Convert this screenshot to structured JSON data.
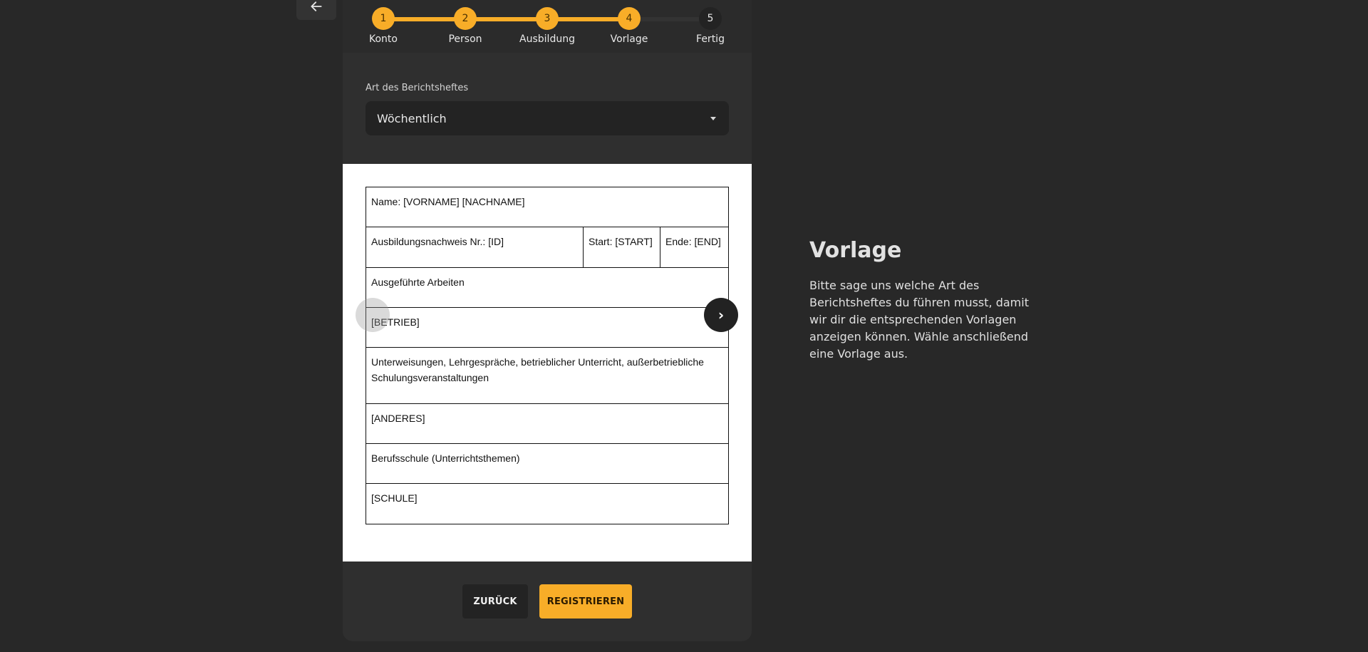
{
  "stepper": {
    "steps": [
      {
        "number": "1",
        "label": "Konto",
        "state": "done"
      },
      {
        "number": "2",
        "label": "Person",
        "state": "done"
      },
      {
        "number": "3",
        "label": "Ausbildung",
        "state": "done"
      },
      {
        "number": "4",
        "label": "Vorlage",
        "state": "current"
      },
      {
        "number": "5",
        "label": "Fertig",
        "state": "todo"
      }
    ],
    "accent_color": "#f8ad28"
  },
  "form": {
    "type_label": "Art des Berichtsheftes",
    "type_value": "Wöchentlich"
  },
  "template_preview": {
    "name": "Name: [VORNAME] [NACHNAME]",
    "nachweis": "Ausbildungsnachweis Nr.: [ID]",
    "start": "Start: [START]",
    "ende": "Ende: [END]",
    "arbeiten": "Ausgeführte Arbeiten",
    "betrieb": "[BETRIEB]",
    "unterweisungen": "Unterweisungen, Lehrgespräche, betrieblicher Unterricht, außerbetriebliche Schulungsveranstaltungen",
    "anderes": "[ANDERES]",
    "berufsschule": "Berufsschule (Unterrichtsthemen)",
    "schule": "[SCHULE]",
    "next_glyph": "›"
  },
  "buttons": {
    "back": "ZURÜCK",
    "register": "REGISTRIEREN"
  },
  "info": {
    "title": "Vorlage",
    "text": "Bitte sage uns welche Art des Berichtsheftes du führen musst, damit wir dir die entsprechenden Vorlagen anzeigen können. Wähle anschließend eine Vorlage aus."
  },
  "icons": {
    "back": "arrow-left-icon",
    "dropdown": "caret-down-icon"
  }
}
